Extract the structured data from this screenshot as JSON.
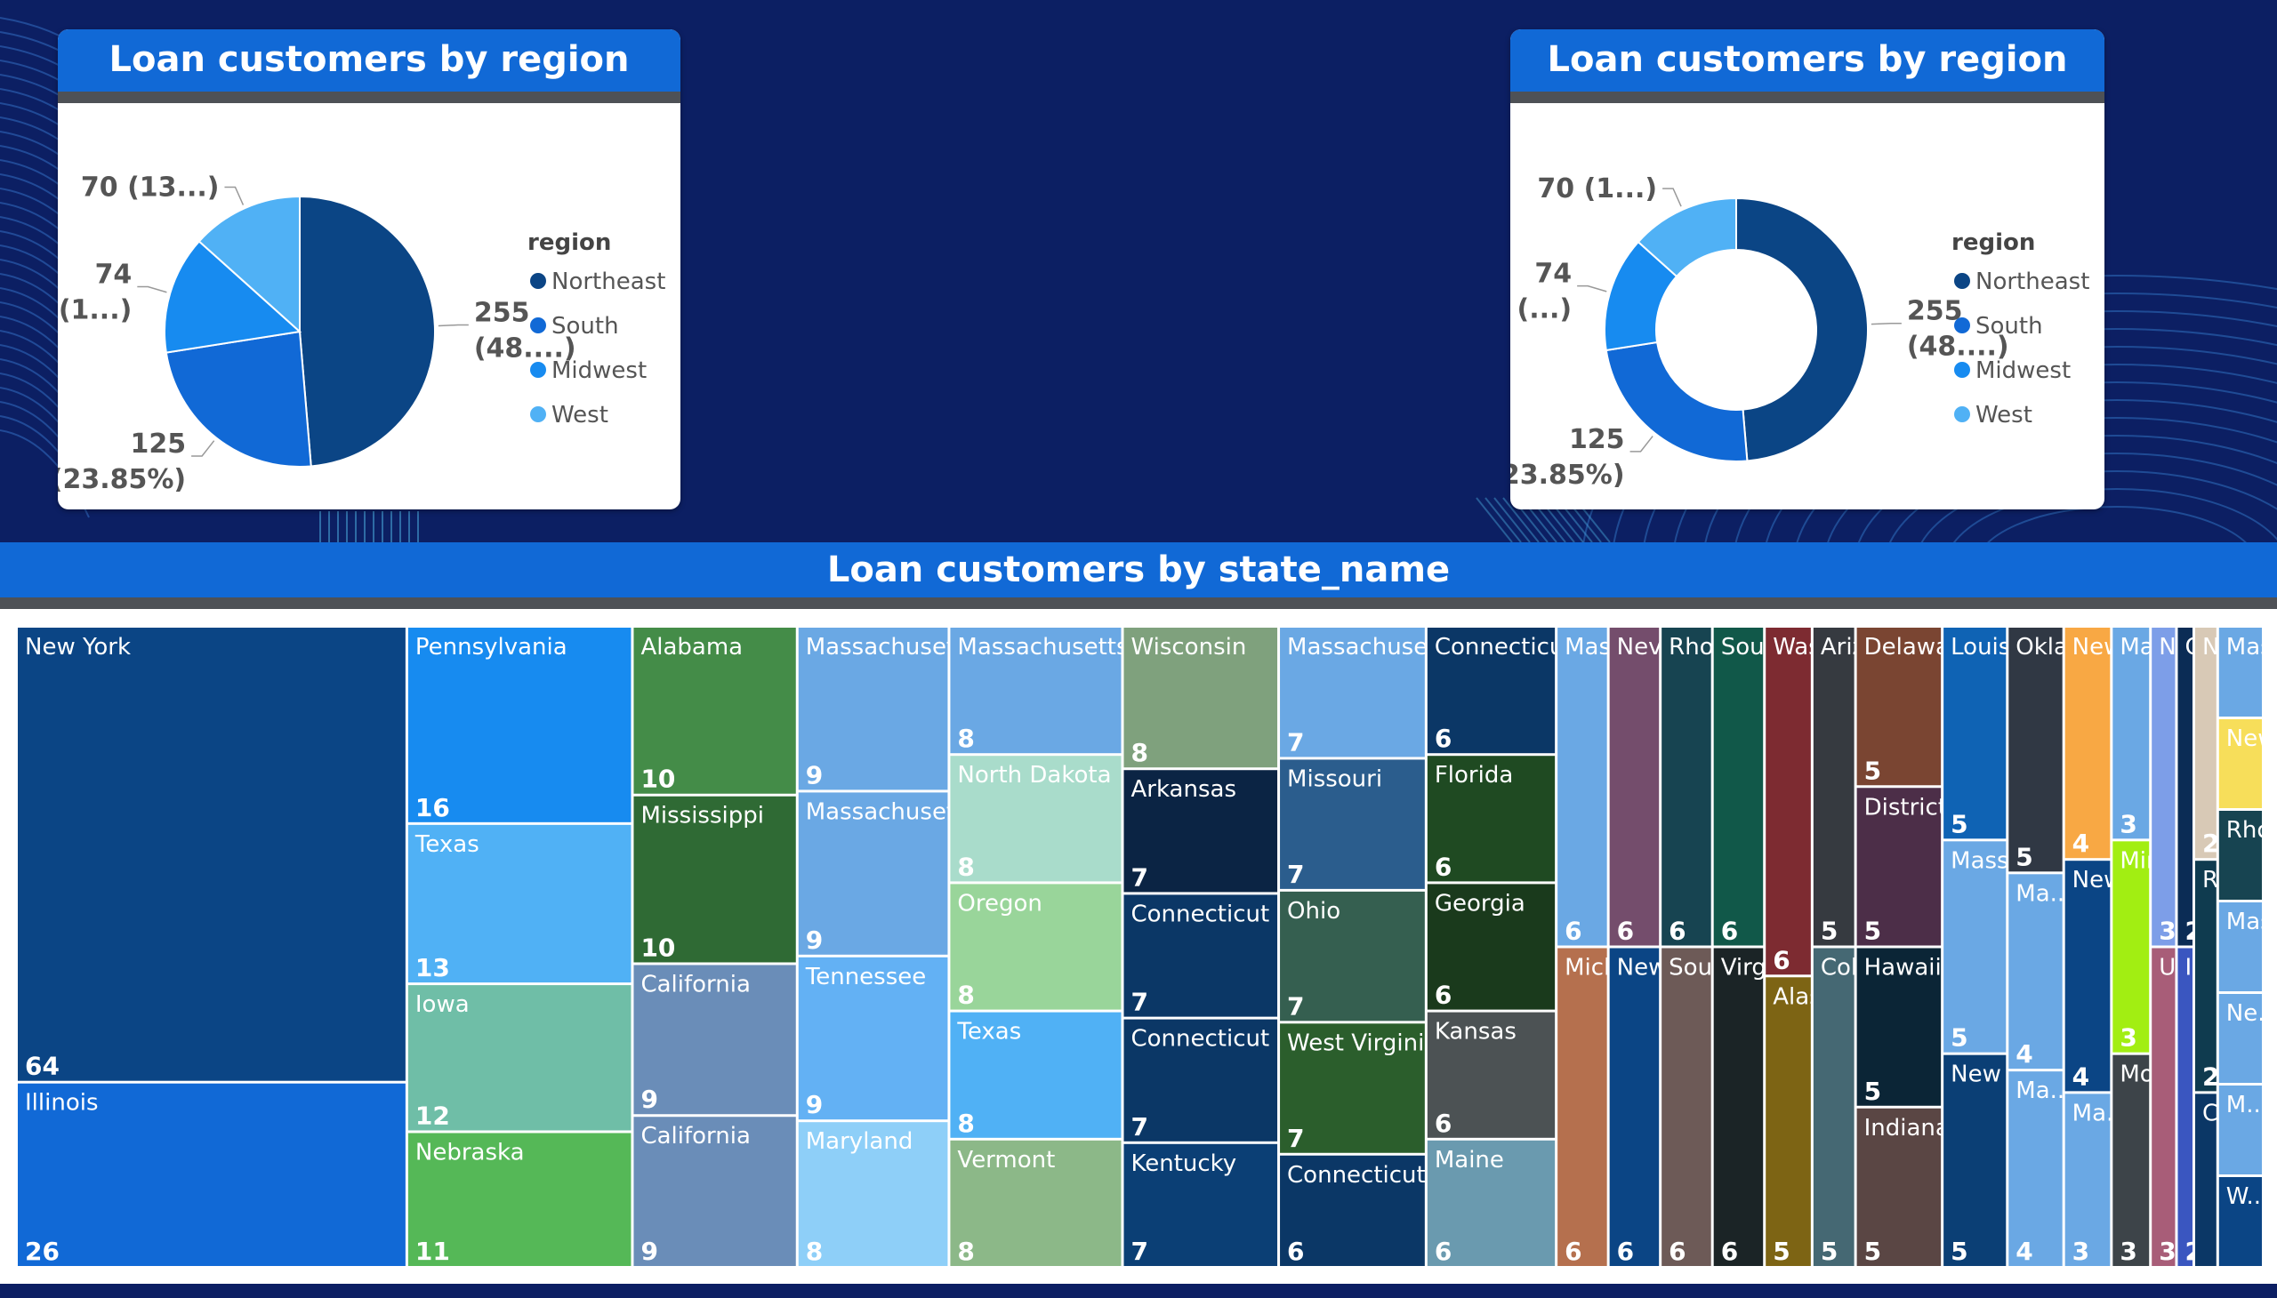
{
  "colors": {
    "northeast": "#0b4585",
    "south": "#1169d6",
    "midwest": "#178bf0",
    "west": "#50b1f5"
  },
  "charts": {
    "pie": {
      "title": "Loan customers by region"
    },
    "donut": {
      "title": "Loan customers by region"
    },
    "treemap": {
      "title": "Loan customers by state_name"
    }
  },
  "chart_data": [
    {
      "type": "pie",
      "title": "Loan customers by region",
      "legend_title": "region",
      "legend_position": "right",
      "series": [
        {
          "name": "Northeast",
          "value": 255,
          "label_line1": "255",
          "label_line2": "(48....)"
        },
        {
          "name": "South",
          "value": 125,
          "label_line1": "125",
          "label_line2": "(23.85%)"
        },
        {
          "name": "Midwest",
          "value": 74,
          "label_line1": "74",
          "label_line2": "(1...)"
        },
        {
          "name": "West",
          "value": 70,
          "label_line1": "70 (13...)",
          "label_line2": ""
        }
      ]
    },
    {
      "type": "pie",
      "subtype": "donut",
      "title": "Loan customers by region",
      "legend_title": "region",
      "legend_position": "right",
      "series": [
        {
          "name": "Northeast",
          "value": 255,
          "label_line1": "255",
          "label_line2": "(48....)"
        },
        {
          "name": "South",
          "value": 125,
          "label_line1": "125",
          "label_line2": "(23.85%)"
        },
        {
          "name": "Midwest",
          "value": 74,
          "label_line1": "74",
          "label_line2": "(...)"
        },
        {
          "name": "West",
          "value": 70,
          "label_line1": "70 (1...)",
          "label_line2": ""
        }
      ]
    },
    {
      "type": "treemap",
      "title": "Loan customers by state_name",
      "cells": [
        {
          "label": "New York",
          "value": 64,
          "color": "#0b4585"
        },
        {
          "label": "Illinois",
          "value": 26,
          "color": "#1169d6"
        },
        {
          "label": "Pennsylvania",
          "value": 16,
          "color": "#178bf0"
        },
        {
          "label": "Texas",
          "value": 13,
          "color": "#50b1f5"
        },
        {
          "label": "Iowa",
          "value": 12,
          "color": "#6fbea7"
        },
        {
          "label": "Nebraska",
          "value": 11,
          "color": "#55b857"
        },
        {
          "label": "Alabama",
          "value": 10,
          "color": "#448c48"
        },
        {
          "label": "Mississippi",
          "value": 10,
          "color": "#2f6a34"
        },
        {
          "label": "California",
          "value": 9,
          "color": "#6a8db8"
        },
        {
          "label": "California",
          "value": 9,
          "color": "#6a8db8"
        },
        {
          "label": "Massachusetts",
          "value": 9,
          "color": "#6aa8e4"
        },
        {
          "label": "Massachusetts",
          "value": 9,
          "color": "#6aa8e4"
        },
        {
          "label": "Tennessee",
          "value": 9,
          "color": "#63b1f4"
        },
        {
          "label": "Maryland",
          "value": 8,
          "color": "#8ecff8"
        },
        {
          "label": "Massachusetts",
          "value": 8,
          "color": "#6aa8e4"
        },
        {
          "label": "North Dakota",
          "value": 8,
          "color": "#a9dccb"
        },
        {
          "label": "Oregon",
          "value": 8,
          "color": "#99d59a"
        },
        {
          "label": "Texas",
          "value": 8,
          "color": "#50b1f5"
        },
        {
          "label": "Vermont",
          "value": 8,
          "color": "#8cb888"
        },
        {
          "label": "Wisconsin",
          "value": 8,
          "color": "#7fa17d"
        },
        {
          "label": "Arkansas",
          "value": 7,
          "color": "#0b2444"
        },
        {
          "label": "Connecticut",
          "value": 7,
          "color": "#0b3766"
        },
        {
          "label": "Connecticut",
          "value": 7,
          "color": "#0b3766"
        },
        {
          "label": "Kentucky",
          "value": 7,
          "color": "#0b3f75"
        },
        {
          "label": "Massachusetts",
          "value": 7,
          "color": "#6aa8e4"
        },
        {
          "label": "Missouri",
          "value": 7,
          "color": "#2b5d8d"
        },
        {
          "label": "Ohio",
          "value": 7,
          "color": "#355f50"
        },
        {
          "label": "West Virginia",
          "value": 7,
          "color": "#2b5e2c"
        },
        {
          "label": "Connecticut",
          "value": 6,
          "color": "#0b3766"
        },
        {
          "label": "Connecticut",
          "value": 6,
          "color": "#0b3766"
        },
        {
          "label": "Florida",
          "value": 6,
          "color": "#1f4a22"
        },
        {
          "label": "Georgia",
          "value": 6,
          "color": "#1a3a1c"
        },
        {
          "label": "Kansas",
          "value": 6,
          "color": "#4c5254"
        },
        {
          "label": "Maine",
          "value": 6,
          "color": "#6a9aaf"
        },
        {
          "label": "Massachus...",
          "value": 6,
          "color": "#6aa8e4"
        },
        {
          "label": "Michigan",
          "value": 6,
          "color": "#b5704e"
        },
        {
          "label": "Nevada",
          "value": 6,
          "color": "#744d6c"
        },
        {
          "label": "New York",
          "value": 6,
          "color": "#0b4585"
        },
        {
          "label": "Rhode Island",
          "value": 6,
          "color": "#174451"
        },
        {
          "label": "South Caro...",
          "value": 6,
          "color": "#6d5a57"
        },
        {
          "label": "South ...",
          "value": 6,
          "color": "#115849"
        },
        {
          "label": "Virginia",
          "value": 6,
          "color": "#1b2426"
        },
        {
          "label": "Washi...",
          "value": 6,
          "color": "#7d2b31"
        },
        {
          "label": "Alaska",
          "value": 5,
          "color": "#7d6414"
        },
        {
          "label": "Ariz...",
          "value": 5,
          "color": "#363a40"
        },
        {
          "label": "Colo...",
          "value": 5,
          "color": "#456873"
        },
        {
          "label": "Delaware",
          "value": 5,
          "color": "#7a4532"
        },
        {
          "label": "District of...",
          "value": 5,
          "color": "#4c2e48"
        },
        {
          "label": "Hawaii",
          "value": 5,
          "color": "#0b2536"
        },
        {
          "label": "Indiana",
          "value": 5,
          "color": "#5a4644"
        },
        {
          "label": "Louisiana",
          "value": 5,
          "color": "#0f63b4"
        },
        {
          "label": "Mass...",
          "value": 5,
          "color": "#6aa8e4"
        },
        {
          "label": "New ...",
          "value": 5,
          "color": "#0b3f75"
        },
        {
          "label": "Okla...",
          "value": 5,
          "color": "#303844"
        },
        {
          "label": "Ma...",
          "value": 4,
          "color": "#6aa8e4"
        },
        {
          "label": "Ma...",
          "value": 4,
          "color": "#6aa8e4"
        },
        {
          "label": "New Je...",
          "value": 4,
          "color": "#f8a844"
        },
        {
          "label": "New Yo...",
          "value": 4,
          "color": "#0b4585"
        },
        {
          "label": "Ma...",
          "value": 3,
          "color": "#6aa8e4"
        },
        {
          "label": "Ma...",
          "value": 3,
          "color": "#6aa8e4"
        },
        {
          "label": "Min...",
          "value": 3,
          "color": "#a2ee12"
        },
        {
          "label": "Mo...",
          "value": 3,
          "color": "#3d4449"
        },
        {
          "label": "New H...",
          "value": 3,
          "color": "#7d9ee8"
        },
        {
          "label": "Utah",
          "value": 3,
          "color": "#a85d78"
        },
        {
          "label": "C...",
          "value": 2,
          "color": "#0b2c55"
        },
        {
          "label": "Id...",
          "value": 2,
          "color": "#3a56c0"
        },
        {
          "label": "N...",
          "value": 2,
          "color": "#d8c9b6"
        },
        {
          "label": "R...",
          "value": 2,
          "color": "#0f3b4f"
        },
        {
          "label": "Connec...",
          "value": null,
          "color": "#0b3766"
        },
        {
          "label": "Massac...",
          "value": null,
          "color": "#6aa8e4"
        },
        {
          "label": "New ...",
          "value": null,
          "color": "#f7de5a"
        },
        {
          "label": "Rhode...",
          "value": null,
          "color": "#174451"
        },
        {
          "label": "Mas...",
          "value": null,
          "color": "#6aa8e4"
        },
        {
          "label": "Ne...",
          "value": null,
          "color": "#6aa8e4"
        },
        {
          "label": "M...",
          "value": null,
          "color": "#6aa8e4"
        },
        {
          "label": "W...",
          "value": null,
          "color": "#0b4585"
        }
      ]
    }
  ]
}
